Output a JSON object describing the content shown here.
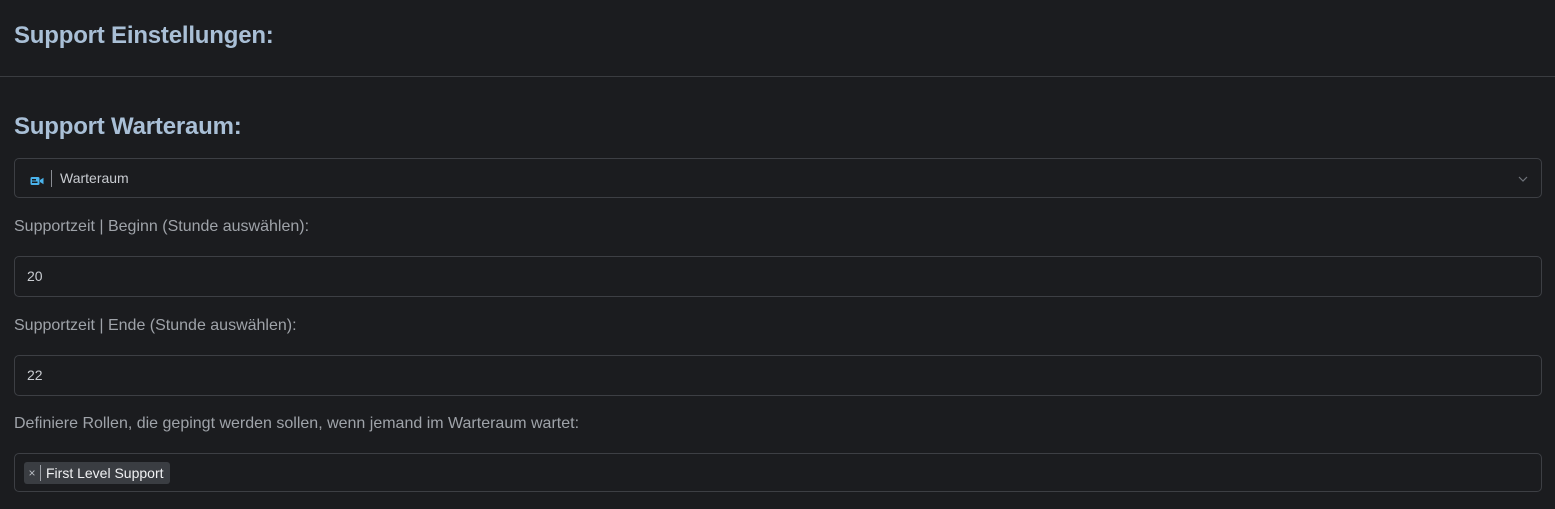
{
  "settings": {
    "title": "Support Einstellungen:"
  },
  "waiting_room": {
    "title": "Support Warteraum:",
    "channel_select": {
      "selected_label": "Warteraum",
      "icon": "video-camera-icon"
    }
  },
  "support_time": {
    "begin_label": "Supportzeit | Beginn (Stunde auswählen):",
    "begin_value": "20",
    "end_label": "Supportzeit | Ende (Stunde auswählen):",
    "end_value": "22"
  },
  "roles": {
    "label": "Definiere Rollen, die gepingt werden sollen, wenn jemand im Warteraum wartet:",
    "remove_symbol": "×",
    "tags": [
      "First Level Support"
    ]
  },
  "colors": {
    "background": "#1b1c1f",
    "heading": "#a9bfd6",
    "border": "#3d3f44",
    "tag_bg": "#3a3d42",
    "icon_accent": "#4ab3ec"
  }
}
